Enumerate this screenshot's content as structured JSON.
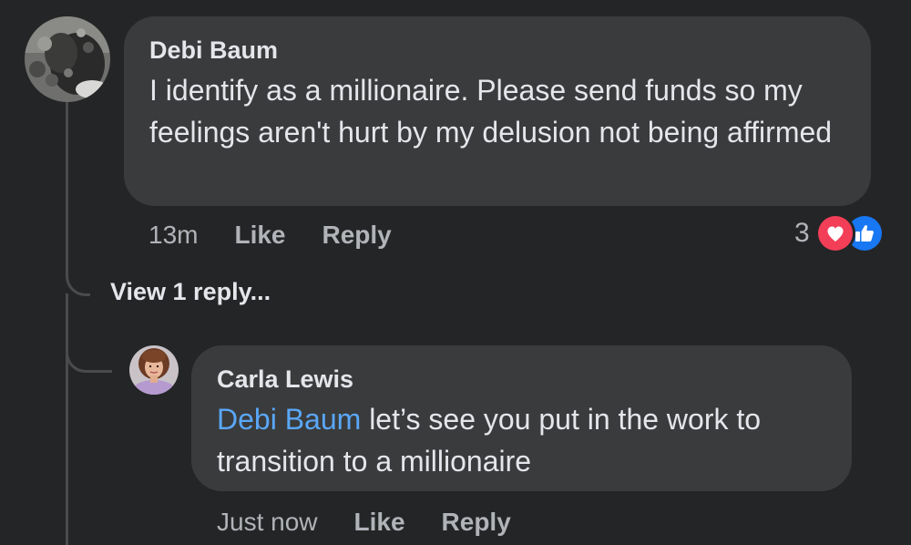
{
  "comments": [
    {
      "author": "Debi Baum",
      "text": "I identify as a millionaire. Please send funds so my feelings aren't hurt by my delusion not being affirmed",
      "timestamp": "13m",
      "like_label": "Like",
      "reply_label": "Reply",
      "reaction_count": "3",
      "reactions": [
        "love-icon",
        "like-icon"
      ],
      "avatar_icon": "dog-photo-avatar"
    }
  ],
  "view_replies_label": "View 1 reply...",
  "reply": {
    "author": "Carla Lewis",
    "mention": "Debi Baum",
    "text": " let’s see you put in the work to transition to a millionaire",
    "timestamp": "Just now",
    "like_label": "Like",
    "reply_label": "Reply",
    "avatar_icon": "woman-photo-avatar"
  },
  "colors": {
    "background": "#242526",
    "bubble": "#3a3b3c",
    "text": "#e4e6eb",
    "secondary_text": "#b0b3b8",
    "mention": "#5aa7f8",
    "love": "#f33e58",
    "like": "#1877f2"
  }
}
